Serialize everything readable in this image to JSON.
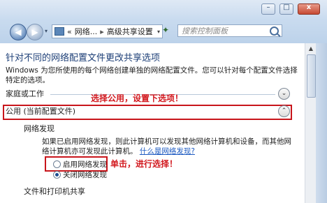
{
  "window": {
    "minimize_glyph": "–",
    "maximize_glyph": "□",
    "close_glyph": "x"
  },
  "nav": {
    "back_glyph": "◀",
    "forward_glyph": "▶",
    "dropdown_glyph": "▾"
  },
  "address": {
    "prefix": "«",
    "crumb1": "网络...",
    "separator": "▸",
    "crumb2": "高级共享设置",
    "dropdown_glyph": "▾",
    "refresh_glyph": "✦"
  },
  "search": {
    "placeholder": "搜索控制面板"
  },
  "page": {
    "title": "针对不同的网络配置文件更改共享选项",
    "description": "Windows 为您所使用的每个网络创建单独的网络配置文件。您可以针对每个配置文件选择特定的选项。"
  },
  "groups": {
    "home_work": {
      "label": "家庭或工作",
      "chevron": "⌄"
    },
    "public": {
      "label": "公用 (当前配置文件)",
      "chevron": "⌃"
    }
  },
  "annotations": {
    "select_public": "选择公用，设置下选项！",
    "click_apply": "单击，进行选择！"
  },
  "network_discovery": {
    "heading": "网络发现",
    "text": "如果已启用网络发现，则此计算机可以发现其他网络计算机和设备，而其他网络计算机亦可发现此计算机。",
    "link": "什么是网络发现?",
    "option_on": "启用网络发现",
    "option_off": "关闭网络发现"
  },
  "file_printer": {
    "heading": "文件和打印机共享"
  },
  "scrollbar": {
    "up_glyph": "▲"
  }
}
